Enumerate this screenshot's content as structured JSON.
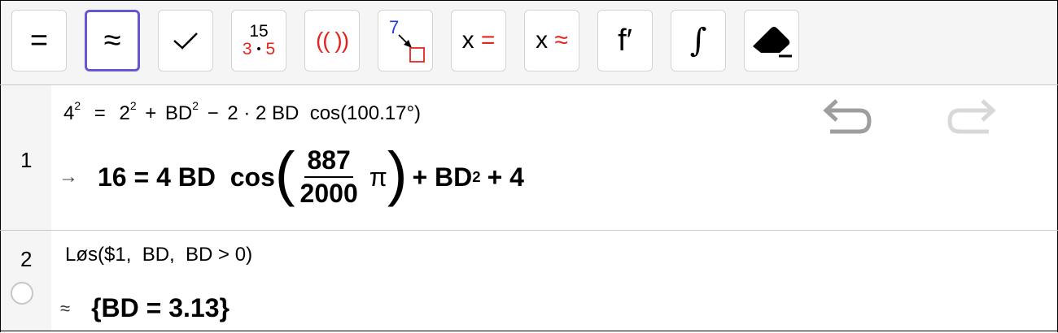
{
  "toolbar": {
    "buttons": [
      {
        "name": "evaluate",
        "label": "="
      },
      {
        "name": "numeric",
        "label": "≈"
      },
      {
        "name": "keep-input",
        "label": "✓"
      },
      {
        "name": "factor",
        "top": "15",
        "bottom_left": "3",
        "bottom_dot": "•",
        "bottom_right": "5"
      },
      {
        "name": "expand",
        "label": "(( ))"
      },
      {
        "name": "substitute",
        "label": "7"
      },
      {
        "name": "solve",
        "x": "x",
        "op": "="
      },
      {
        "name": "solve-numerically",
        "x": "x",
        "op": "≈"
      },
      {
        "name": "derivative",
        "label": "f′"
      },
      {
        "name": "integral",
        "label": "∫"
      },
      {
        "name": "delete",
        "label": ""
      }
    ]
  },
  "rows": [
    {
      "index": "1",
      "input": {
        "lhs_base": "4",
        "lhs_exp": "2",
        "eq": "=",
        "t1_base": "2",
        "t1_exp": "2",
        "plus": "+",
        "t2_base": "BD",
        "t2_exp": "2",
        "minus": "−",
        "t3": "2 · 2 BD  cos(100.17°)"
      },
      "output": {
        "arrow": "→",
        "lhs": "16 = 4 BD  cos",
        "num": "887",
        "den": "2000",
        "pi": "π",
        "rest": "+ BD",
        "rest_exp": "2",
        "tail": "+ 4"
      }
    },
    {
      "index": "2",
      "input": "Løs($1,  BD,  BD > 0)",
      "output": {
        "marker": "≈",
        "value": "{BD = 3.13}"
      }
    }
  ],
  "colors": {
    "accent": "#6557d2",
    "red": "#e52420",
    "blue": "#1d3be0",
    "icon_gray": "#9e9e9e"
  }
}
